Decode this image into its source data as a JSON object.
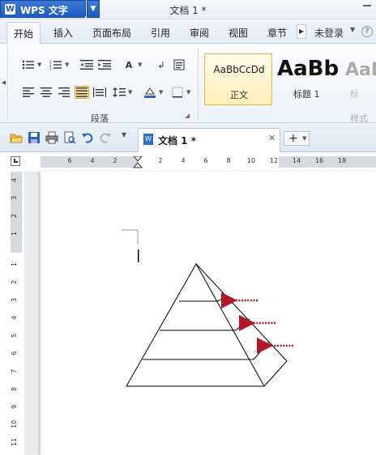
{
  "title_bar": {
    "app_button": "WPS 文字",
    "document_title": "文档 1 *"
  },
  "menu": {
    "tabs": [
      "开始",
      "插入",
      "页面布局",
      "引用",
      "审阅",
      "视图",
      "章节"
    ],
    "login": "未登录"
  },
  "ribbon": {
    "paragraph_group_label": "段落",
    "styles": [
      {
        "sample": "AaBbCcDd",
        "name": "正文"
      },
      {
        "sample": "AaBb(",
        "name": "标题 1"
      },
      {
        "sample": "AaB",
        "name": "标"
      }
    ],
    "styles_group_label": "样式"
  },
  "doc_tabs": {
    "active_tab": "文档 1 *",
    "new_tab": "+"
  },
  "ruler": {
    "horizontal_ticks": [
      "6",
      "4",
      "2",
      "2",
      "4",
      "6",
      "8",
      "10",
      "12",
      "14",
      "16",
      "18"
    ],
    "vertical_ticks": [
      "4",
      "3",
      "2",
      "1",
      "1",
      "2",
      "3",
      "4",
      "5",
      "6",
      "7",
      "8",
      "9",
      "10",
      "11"
    ]
  },
  "colors": {
    "arrow": "#b3182a",
    "accent": "#1f5bbd",
    "selected_style_border": "#e6b64a"
  }
}
